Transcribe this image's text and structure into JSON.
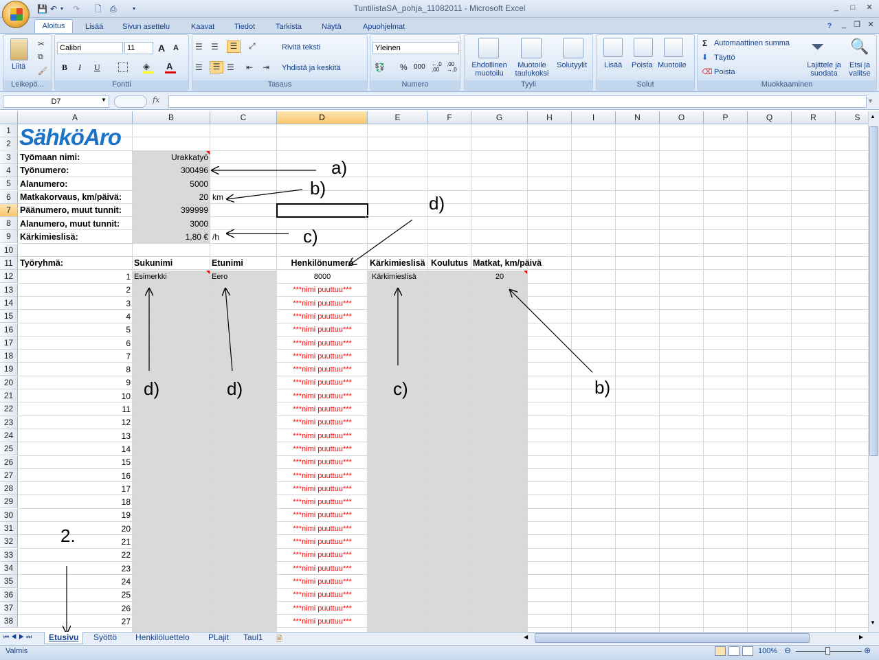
{
  "window": {
    "title": "TuntilistaSA_pohja_11082011 - Microsoft Excel",
    "min": "_",
    "max": "□",
    "close": "✕",
    "doc_min": "_",
    "doc_restore": "❐",
    "doc_close": "✕",
    "help": "?"
  },
  "tabs": [
    "Aloitus",
    "Lisää",
    "Sivun asettelu",
    "Kaavat",
    "Tiedot",
    "Tarkista",
    "Näytä",
    "Apuohjelmat"
  ],
  "ribbon": {
    "clipboard": {
      "label": "Leikepö...",
      "paste": "Liitä"
    },
    "font": {
      "label": "Fontti",
      "name": "Calibri",
      "size": "11",
      "bold": "B",
      "italic": "I",
      "underline": "U",
      "grow": "A",
      "shrink": "A"
    },
    "alignment": {
      "label": "Tasaus",
      "wrap": "Rivitä teksti",
      "merge": "Yhdistä ja keskitä"
    },
    "number": {
      "label": "Numero",
      "format": "Yleinen",
      "percent": "%",
      "thousands": "000",
      "inc": ",0\n.00",
      "dec": ",00\n,0"
    },
    "styles": {
      "label": "Tyyli",
      "cond": "Ehdollinen muotoilu",
      "table": "Muotoile taulukoksi",
      "cell": "Solutyylit"
    },
    "cells": {
      "label": "Solut",
      "insert": "Lisää",
      "delete": "Poista",
      "format": "Muotoile"
    },
    "editing": {
      "label": "Muokkaaminen",
      "autosum": "Automaattinen summa",
      "fill": "Täyttö",
      "clear": "Poista",
      "sort": "Lajittele ja suodata",
      "find": "Etsi ja valitse"
    }
  },
  "formula_bar": {
    "name_box": "D7",
    "fx": "fx",
    "value": ""
  },
  "columns": [
    "A",
    "B",
    "C",
    "D",
    "E",
    "F",
    "G",
    "H",
    "I",
    "N",
    "O",
    "P",
    "Q",
    "R",
    "S"
  ],
  "rows": [
    "1",
    "2",
    "3",
    "4",
    "5",
    "6",
    "7",
    "8",
    "9",
    "10",
    "11",
    "12",
    "13",
    "14",
    "15",
    "16",
    "17",
    "18",
    "19",
    "20",
    "21",
    "22",
    "23",
    "24",
    "25",
    "26",
    "27",
    "28",
    "29",
    "30",
    "31",
    "32",
    "33",
    "34",
    "35",
    "36",
    "37",
    "38"
  ],
  "logo_text": "SähköAro",
  "header_labels": [
    {
      "label": "Työmaan nimi:",
      "value": "Urakkatyö",
      "unit": ""
    },
    {
      "label": "Työnumero:",
      "value": "300496",
      "unit": ""
    },
    {
      "label": "Alanumero:",
      "value": "5000",
      "unit": ""
    },
    {
      "label": "Matkakorvaus, km/päivä:",
      "value": "20",
      "unit": "km"
    },
    {
      "label": "Päänumero, muut tunnit:",
      "value": "399999",
      "unit": ""
    },
    {
      "label": "Alanumero, muut tunnit:",
      "value": "3000",
      "unit": ""
    },
    {
      "label": "Kärkimieslisä:",
      "value": "1,80 €",
      "unit": "/h"
    }
  ],
  "table": {
    "title": "Työryhmä:",
    "headers": [
      "Sukunimi",
      "Etunimi",
      "Henkilönumero",
      "Kärkimieslisä",
      "Koulutus",
      "Matkat, km/päivä"
    ],
    "first_row": {
      "num": "1",
      "sukunimi": "Esimerkki",
      "etunimi": "Eero",
      "henkilonumero": "8000",
      "karkimieslisa": "Kärkimieslisä",
      "matkat": "20"
    },
    "missing_name": "***nimi puuttuu***",
    "row_numbers": [
      "2",
      "3",
      "4",
      "5",
      "6",
      "7",
      "8",
      "9",
      "10",
      "11",
      "12",
      "13",
      "14",
      "15",
      "16",
      "17",
      "18",
      "19",
      "20",
      "21",
      "22",
      "23",
      "24",
      "25",
      "26",
      "27"
    ]
  },
  "annotations": {
    "a": "a)",
    "b": "b)",
    "c": "c)",
    "d": "d)",
    "two": "2."
  },
  "sheet_tabs": [
    "Etusivu",
    "Syöttö",
    "Henkilöluettelo",
    "PLajit",
    "Taul1"
  ],
  "status": {
    "ready": "Valmis",
    "zoom": "100%"
  }
}
